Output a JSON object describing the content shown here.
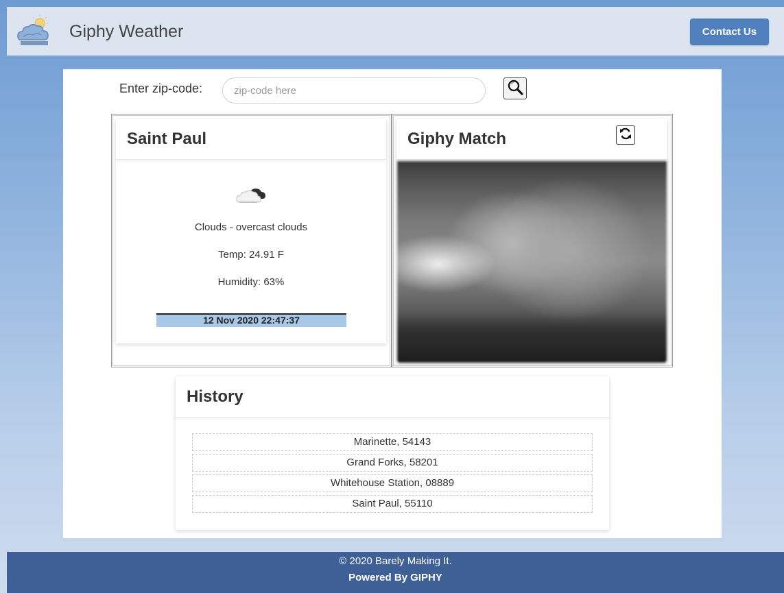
{
  "header": {
    "title": "Giphy Weather",
    "contact_label": "Contact Us"
  },
  "search": {
    "label": "Enter zip-code:",
    "placeholder": "zip-code here"
  },
  "weather": {
    "city": "Saint Paul",
    "icon": "cloud-icon",
    "description": "Clouds - overcast clouds",
    "temp": "Temp: 24.91 F",
    "humidity": "Humidity: 63%",
    "timestamp": "12 Nov 2020 22:47:37"
  },
  "giphy": {
    "title": "Giphy Match",
    "refresh_icon": "refresh-icon"
  },
  "history": {
    "title": "History",
    "items": [
      "Marinette, 54143",
      "Grand Forks, 58201",
      "Whitehouse Station, 08889",
      "Saint Paul, 55110"
    ]
  },
  "footer": {
    "copyright": "© 2020 Barely Making It.",
    "powered": "Powered By GIPHY"
  },
  "colors": {
    "contact_button": "#4f7fbd",
    "header_bg": "#dbe4ef",
    "footer_bg": "#3f5f97",
    "timestamp_bg": "#a9c7e6"
  }
}
